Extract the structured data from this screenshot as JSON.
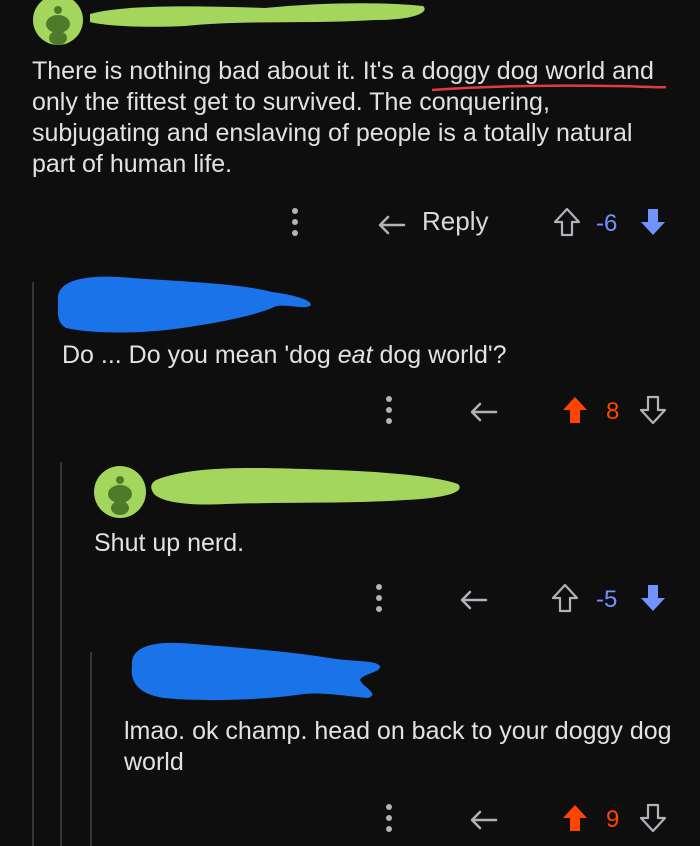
{
  "comments": [
    {
      "text": "There is nothing bad about it. It's a doggy dog world and only the fittest get to survived. The conquering, subjugating and enslaving of people is a totally natural part of human life.",
      "text_parts": [
        "There is nothing bad about it. It's a ",
        "doggy dog world",
        " and only the fittest get to survived. The conquering, subjugating and enslaving of people is a totally natural part of human life."
      ],
      "reply_label": "Reply",
      "score": "-6",
      "vote": "down"
    },
    {
      "text_parts": [
        "Do ... Do you mean 'dog ",
        "eat",
        " dog world'?"
      ],
      "score": "8",
      "vote": "up"
    },
    {
      "text": "Shut up nerd.",
      "score": "-5",
      "vote": "down"
    },
    {
      "text": "lmao. ok champ. head on back to your doggy dog world",
      "score": "9",
      "vote": "up"
    }
  ],
  "colors": {
    "background": "#0e0e0f",
    "text": "#e2e2e2",
    "upvote": "#ff4500",
    "downvote": "#7193ff",
    "redact_green": "#a4d65e",
    "redact_blue": "#1a73e8",
    "underline_red": "#e03c3c"
  }
}
